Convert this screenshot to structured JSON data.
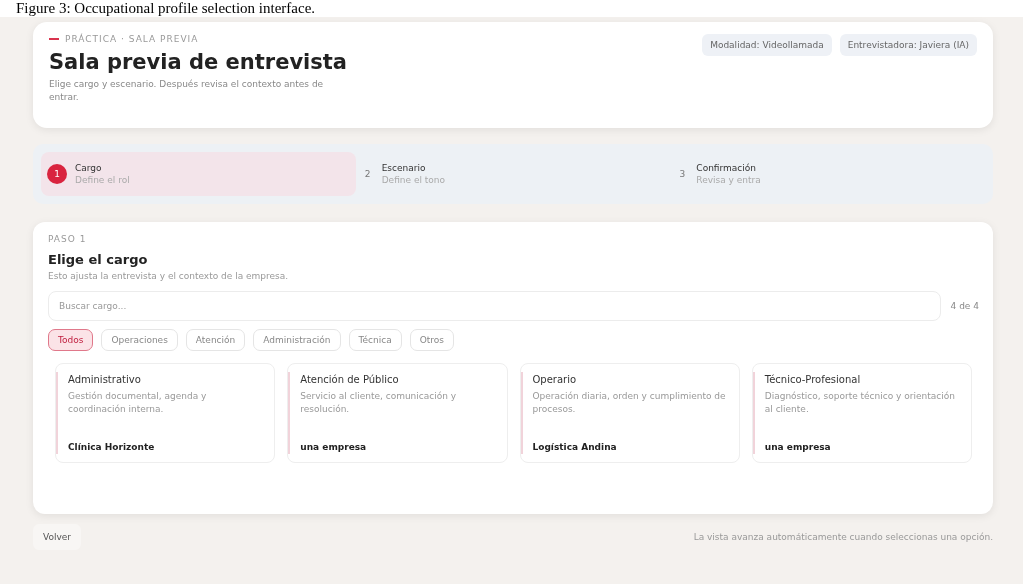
{
  "caption": "Figure 3: Occupational profile selection interface.",
  "header": {
    "eyebrow": "PRÁCTICA · SALA PREVIA",
    "title": "Sala previa de entrevista",
    "subtitle": "Elige cargo y escenario. Después revisa el contexto antes de entrar.",
    "chips": [
      "Modalidad: Videollamada",
      "Entrevistadora: Javiera (IA)"
    ]
  },
  "steps": [
    {
      "number": "1",
      "label": "Cargo",
      "hint": "Define el rol",
      "selected": true
    },
    {
      "number": "2",
      "label": "Escenario",
      "hint": "Define el tono",
      "selected": false
    },
    {
      "number": "3",
      "label": "Confirmación",
      "hint": "Revisa y entra",
      "selected": false
    }
  ],
  "panel": {
    "eyebrow": "PASO 1",
    "title": "Elige el cargo",
    "subtitle": "Esto ajusta la entrevista y el contexto de la empresa.",
    "search": {
      "placeholder": "Buscar cargo..."
    },
    "count": "4 de 4",
    "filters": [
      {
        "label": "Todos",
        "selected": true
      },
      {
        "label": "Operaciones",
        "selected": false
      },
      {
        "label": "Atención",
        "selected": false
      },
      {
        "label": "Administración",
        "selected": false
      },
      {
        "label": "Técnica",
        "selected": false
      },
      {
        "label": "Otros",
        "selected": false
      }
    ],
    "cards": [
      {
        "title": "Administrativo",
        "description": "Gestión documental, agenda y coordinación interna.",
        "company": "Clínica Horizonte"
      },
      {
        "title": "Atención de Público",
        "description": "Servicio al cliente, comunicación y resolución.",
        "company": "una empresa"
      },
      {
        "title": "Operario",
        "description": "Operación diaria, orden y cumplimiento de procesos.",
        "company": "Logística Andina"
      },
      {
        "title": "Técnico-Profesional",
        "description": "Diagnóstico, soporte técnico y orientación al cliente.",
        "company": "una empresa"
      }
    ]
  },
  "footer": {
    "back": "Volver",
    "note": "La vista avanza automáticamente cuando seleccionas una opción."
  }
}
